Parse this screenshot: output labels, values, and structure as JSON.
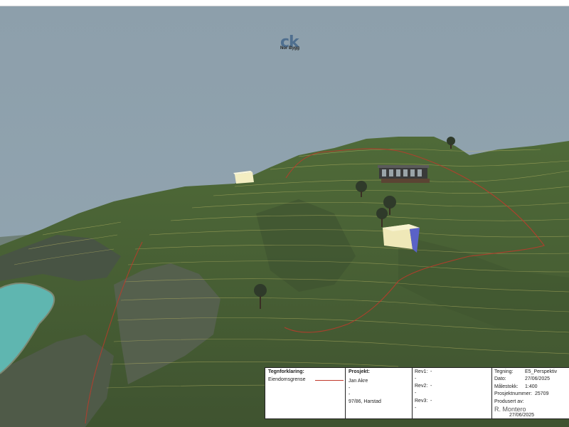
{
  "scene": {
    "sky_color": "#8ea2ae",
    "terrain_color": "#4a6333",
    "water_color": "#5fb6b0",
    "contour_color": "#c9c26a",
    "property_line_color": "#c0392b"
  },
  "legend": {
    "heading": "Tegnforklaring:",
    "item_label": "Eiendomsgrense"
  },
  "project": {
    "heading": "Prosjekt:",
    "lines": [
      "Jan Akre",
      "-",
      "-",
      "97/86, Harstad"
    ]
  },
  "revisions": [
    {
      "label": "Rev1:",
      "value": "-",
      "extra": "-"
    },
    {
      "label": "Rev2:",
      "value": "-",
      "extra": "-"
    },
    {
      "label": "Rev3:",
      "value": "-",
      "extra": "-"
    }
  ],
  "drawing": {
    "tegning_label": "Tegning:",
    "tegning_value": "E5_Perspektiv",
    "dato_label": "Dato:",
    "dato_value": "27/06/2025",
    "malestokk_label": "Målestokk:",
    "malestokk_value": "1:400",
    "prosjektnummer_label": "Prosjektnummer:",
    "prosjektnummer_value": "25709",
    "produsert_label": "Produsert av:",
    "produsert_name": "R. Montero",
    "produsert_date": "27/06/2025"
  },
  "logo": {
    "mark": "ck",
    "company": "Nor Bygg"
  }
}
